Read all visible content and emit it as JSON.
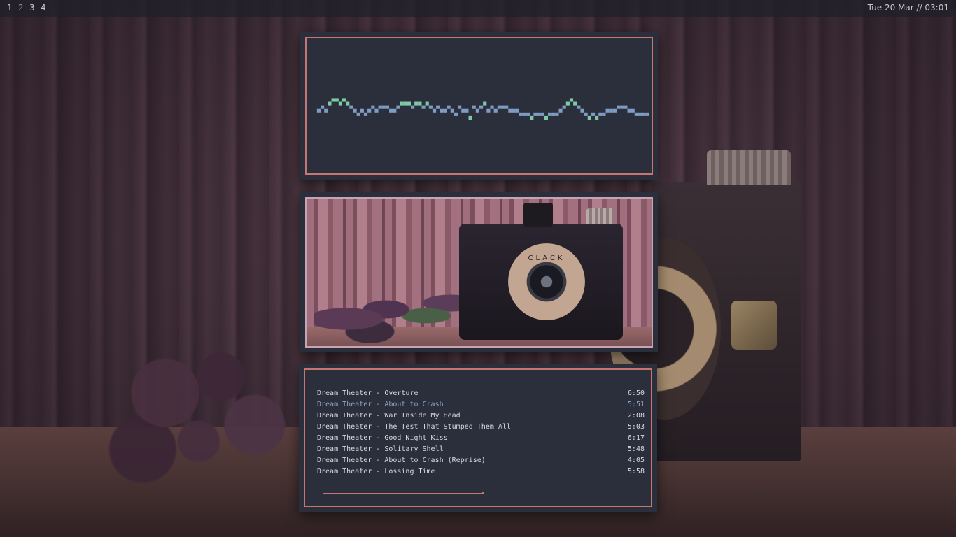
{
  "topbar": {
    "workspaces": [
      "1",
      "2",
      "3",
      "4"
    ],
    "active_workspace": "2",
    "clock": "Tue 20 Mar // 03:01"
  },
  "visualizer": {
    "low_color": "#7f9cc2",
    "high_color": "#7fc9a8",
    "heights": [
      1,
      2,
      1,
      3,
      4,
      4,
      3,
      4,
      3,
      2,
      1,
      0,
      1,
      0,
      1,
      2,
      1,
      2,
      2,
      2,
      1,
      1,
      2,
      3,
      3,
      3,
      2,
      3,
      3,
      2,
      3,
      2,
      1,
      2,
      1,
      1,
      2,
      1,
      0,
      2,
      1,
      1,
      -1,
      2,
      1,
      2,
      3,
      1,
      2,
      1,
      2,
      2,
      2,
      1,
      1,
      1,
      0,
      0,
      0,
      -1,
      0,
      0,
      0,
      -1,
      0,
      0,
      0,
      1,
      2,
      3,
      4,
      3,
      2,
      1,
      0,
      -1,
      0,
      -1,
      0,
      0,
      1,
      1,
      1,
      2,
      2,
      2,
      1,
      1,
      0,
      0,
      0,
      0
    ]
  },
  "album_art": {
    "lens_label": "CLACK"
  },
  "playlist": {
    "tracks": [
      {
        "title": "Dream Theater - Overture",
        "duration": "6:50"
      },
      {
        "title": "Dream Theater - About to Crash",
        "duration": "5:51",
        "playing": true
      },
      {
        "title": "Dream Theater - War Inside My Head",
        "duration": "2:08"
      },
      {
        "title": "Dream Theater - The Test That Stumped Them All",
        "duration": "5:03"
      },
      {
        "title": "Dream Theater - Good Night Kiss",
        "duration": "6:17"
      },
      {
        "title": "Dream Theater - Solitary Shell",
        "duration": "5:48"
      },
      {
        "title": "Dream Theater - About to Crash (Reprise)",
        "duration": "4:05"
      },
      {
        "title": "Dream Theater - Lossing Time",
        "duration": "5:58"
      }
    ],
    "progress_fraction": 0.5,
    "accent_color": "#c97372",
    "playing_color": "#8fa3c6"
  }
}
